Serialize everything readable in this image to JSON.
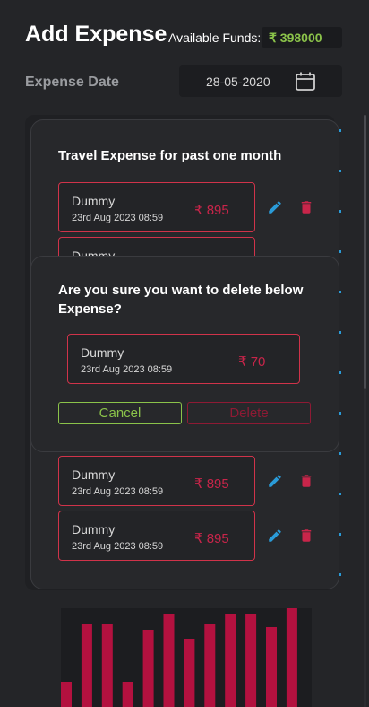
{
  "header": {
    "title": "Add Expense",
    "funds_label": "Available Funds:",
    "funds_value": "₹ 398000"
  },
  "date_field": {
    "label": "Expense Date",
    "value": "28-05-2020"
  },
  "travel_modal": {
    "title": "Travel Expense for past one month",
    "items": [
      {
        "name": "Dummy",
        "date": "23rd Aug 2023  08:59",
        "amount": "₹ 895"
      },
      {
        "name": "Dummy",
        "date": "",
        "amount": ""
      },
      {
        "name": "Dummy",
        "date": "23rd Aug 2023  08:59",
        "amount": "₹ 895"
      },
      {
        "name": "Dummy",
        "date": "23rd Aug 2023  08:59",
        "amount": "₹ 895"
      }
    ]
  },
  "delete_modal": {
    "title": "Are you sure you want to delete below Expense?",
    "item": {
      "name": "Dummy",
      "date": "23rd Aug 2023  08:59",
      "amount": "₹ 70"
    },
    "cancel_label": "Cancel",
    "delete_label": "Delete"
  },
  "colors": {
    "accent_green": "#8bc34a",
    "accent_red": "#c8254a",
    "accent_blue": "#2a9bd8"
  },
  "chart_data": {
    "type": "bar",
    "values": [
      28,
      93,
      93,
      28,
      86,
      104,
      76,
      92,
      104,
      104,
      89,
      110
    ]
  }
}
